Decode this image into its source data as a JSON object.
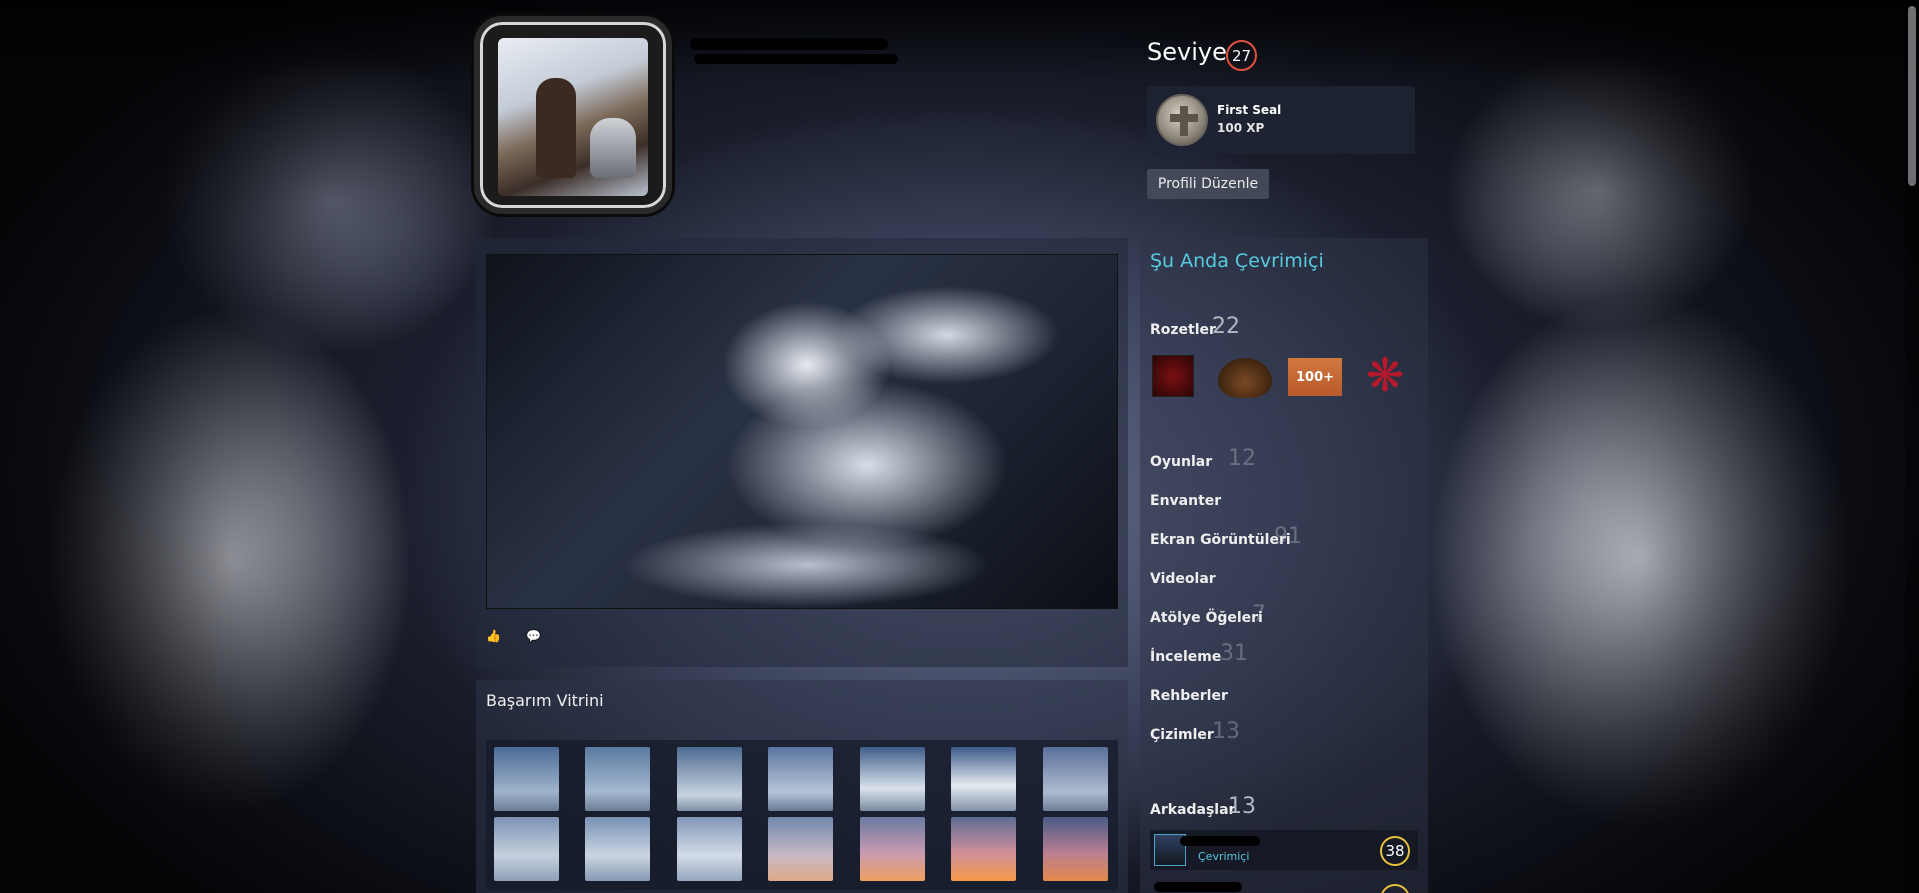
{
  "profile": {
    "level_label": "Seviye",
    "level": "27",
    "featured_badge": {
      "name": "First Seal",
      "xp": "100 XP"
    },
    "edit_button": "Profili Düzenle",
    "online_status": "Şu Anda Çevrimiçi"
  },
  "sidebar": {
    "badges": {
      "label": "Rozetler",
      "count": "22"
    },
    "links": [
      {
        "label": "Oyunlar",
        "count": "12"
      },
      {
        "label": "Envanter",
        "count": ""
      },
      {
        "label": "Ekran Görüntüleri",
        "count": "91"
      },
      {
        "label": "Videolar",
        "count": ""
      },
      {
        "label": "Atölye Öğeleri",
        "count": "7"
      },
      {
        "label": "İnceleme",
        "count": "31"
      },
      {
        "label": "Rehberler",
        "count": ""
      },
      {
        "label": "Çizimler",
        "count": "13"
      }
    ],
    "friends": {
      "label": "Arkadaşlar",
      "count": "13"
    },
    "friend_list": [
      {
        "status": "Çevrimiçi",
        "level": "38"
      }
    ],
    "badge_icons": [
      "badge-gear-icon",
      "cowboy-hat-icon",
      "badge-100-plus-icon",
      "red-emblem-icon"
    ],
    "badge_100_text": "100+"
  },
  "showcase": {
    "title": "Başarım Vitrini"
  },
  "colors": {
    "accent_online": "#57cbde",
    "level_ring": "#e0513f",
    "friend_level_ring": "#e6c03a"
  },
  "icons": {
    "like": "thumbs-up-icon",
    "comment": "comment-icon"
  }
}
